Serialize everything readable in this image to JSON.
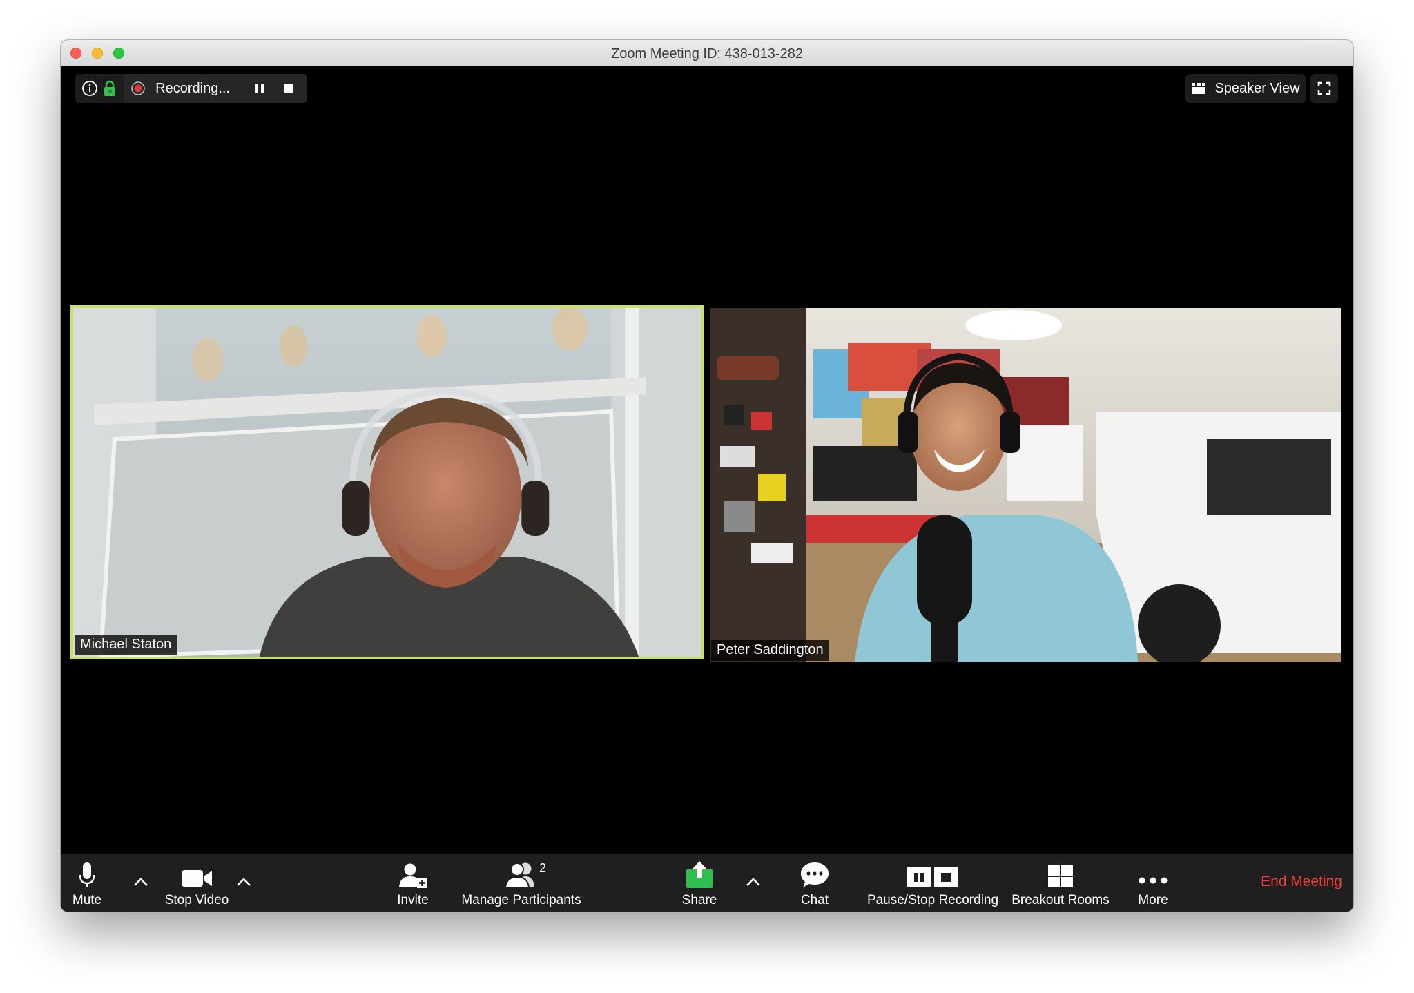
{
  "window": {
    "title": "Zoom Meeting ID: 438-013-282"
  },
  "top_bar": {
    "recording_label": "Recording...",
    "view_label": "Speaker View"
  },
  "participants": [
    {
      "name": "Michael Staton",
      "active_speaker": true,
      "highlight_color": "#c6e26b"
    },
    {
      "name": "Peter Saddington",
      "active_speaker": false
    }
  ],
  "toolbar": {
    "mute_label": "Mute",
    "stop_video_label": "Stop Video",
    "invite_label": "Invite",
    "manage_participants_label": "Manage Participants",
    "participant_count": "2",
    "share_label": "Share",
    "chat_label": "Chat",
    "pause_stop_recording_label": "Pause/Stop Recording",
    "breakout_rooms_label": "Breakout Rooms",
    "more_label": "More",
    "end_meeting_label": "End Meeting"
  },
  "colors": {
    "share_green": "#2fbf4f",
    "end_meeting_red": "#f03d3d",
    "lock_green": "#32c24a",
    "record_red": "#e03b3b"
  }
}
